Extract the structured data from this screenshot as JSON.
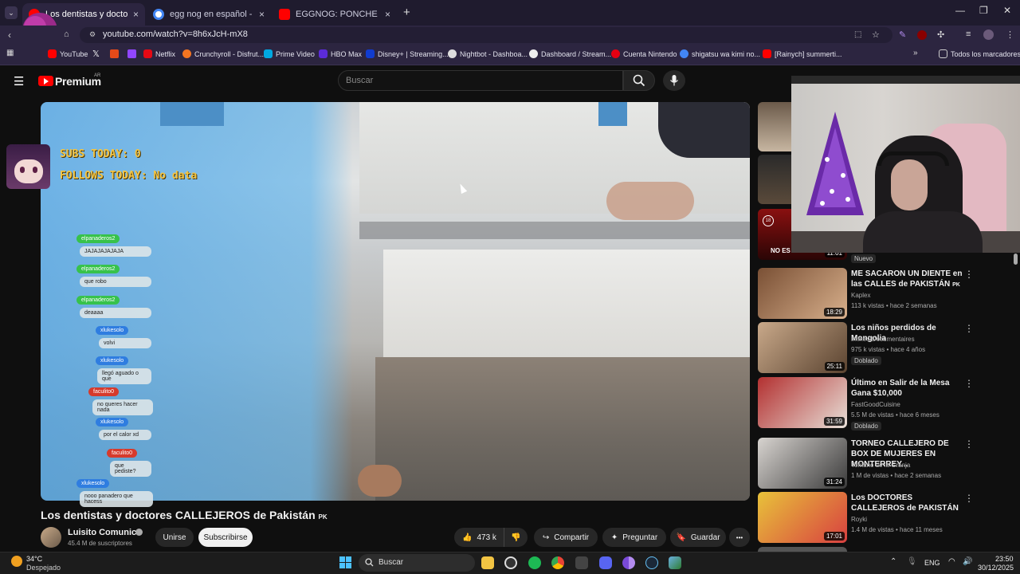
{
  "browser": {
    "tabs": [
      {
        "title": "Los dentistas y doctores CALLEJEROS",
        "active": true
      },
      {
        "title": "egg nog en español - Buscar c...",
        "active": false
      },
      {
        "title": "EGGNOG: PONCHE DE NAVIDA...",
        "active": false
      }
    ],
    "new_tab": "+",
    "close_glyph": "×",
    "url": "youtube.com/watch?v=8h6xJcH-mX8",
    "window_controls": [
      "—",
      "❐",
      "✕"
    ],
    "bookmarks": [
      {
        "label": "YouTube",
        "color": "#ff0000"
      },
      {
        "label": "Netflix",
        "color": "#e50914"
      },
      {
        "label": "Crunchyroll - Disfrut...",
        "color": "#f47521"
      },
      {
        "label": "Prime Video",
        "color": "#00a8e1"
      },
      {
        "label": "HBO Max",
        "color": "#5b2bd9"
      },
      {
        "label": "Disney+ | Streaming...",
        "color": "#113ccf"
      },
      {
        "label": "Nightbot - Dashboa...",
        "color": "#dddddd"
      },
      {
        "label": "Dashboard / Stream...",
        "color": "#eeeeee"
      },
      {
        "label": "Cuenta Nintendo",
        "color": "#e60012"
      },
      {
        "label": "shigatsu wa kimi no...",
        "color": "#4285f4"
      },
      {
        "label": "[Rainych] summerti...",
        "color": "#ff0000"
      }
    ],
    "all_bookmarks": "Todos los marcadores"
  },
  "youtube": {
    "logo": "Premium",
    "region": "AR",
    "search_placeholder": "Buscar",
    "video": {
      "title": "Los dentistas y doctores CALLEJEROS de Pakistán",
      "flag": "PK",
      "channel": "Luisito Comunica",
      "subscribers": "45.4 M de suscriptores",
      "join": "Unirse",
      "subscribe": "Subscribirse",
      "likes": "473 k",
      "share": "Compartir",
      "ask": "Preguntar",
      "save": "Guardar",
      "more": "•••"
    },
    "stream_overlay": {
      "subs_today": "SUBS TODAY: 0",
      "follows_today": "FOLLOWS TODAY: No data",
      "chat": [
        {
          "user": "elpanaderos2",
          "msg": "JAJAJAJAJAJA",
          "color": "#37c24b"
        },
        {
          "user": "elpanaderos2",
          "msg": "que robo",
          "color": "#37c24b"
        },
        {
          "user": "elpanaderos2",
          "msg": "deaaaa",
          "color": "#37c24b"
        },
        {
          "user": "xlukesolo",
          "msg": "volvi",
          "color": "#2f7de0"
        },
        {
          "user": "xlukesolo",
          "msg": "llegó aguado o que",
          "color": "#2f7de0"
        },
        {
          "user": "faculito0",
          "msg": "no queres hacer nada",
          "color": "#d63a2c"
        },
        {
          "user": "xlukesolo",
          "msg": "por el calor xd",
          "color": "#2f7de0"
        },
        {
          "user": "faculito0",
          "msg": "que pediste?",
          "color": "#d63a2c"
        },
        {
          "user": "xlukesolo",
          "msg": "nooo panadero que hacess",
          "color": "#2f7de0"
        }
      ]
    },
    "recommendations": [
      {
        "badge": "Nuevo",
        "title": "",
        "channel": "",
        "meta": "",
        "duration": "11:01",
        "extra": "NO ES"
      },
      {
        "title": "ME SACARON UN DIENTE en las CALLES de PAKISTÁN",
        "flag": "PK",
        "channel": "Kaplex",
        "meta": "113 k vistas • hace 2 semanas",
        "duration": "18:29",
        "badge": ""
      },
      {
        "title": "Los niños perdidos de Mongolia",
        "channel": "imineo Documentaires",
        "meta": "975 k vistas • hace 4 años",
        "duration": "25:11",
        "badge": "Doblado"
      },
      {
        "title": "Último en Salir de la Mesa Gana $10,000",
        "channel": "FastGoodCuisine",
        "meta": "5.5 M de vistas • hace 6 meses",
        "duration": "31:59",
        "badge": "Doblado"
      },
      {
        "title": "TORNEO CALLEJERO DE BOX DE MUJERES EN MONTERREY...",
        "channel": "Tomano de la Granja",
        "meta": "1 M de vistas • hace 2 semanas",
        "duration": "31:24",
        "badge": ""
      },
      {
        "title": "Los DOCTORES CALLEJEROS de PAKISTÁN",
        "channel": "Royki",
        "meta": "1.4 M de vistas • hace 11 meses",
        "duration": "17:01",
        "badge": ""
      }
    ]
  },
  "taskbar": {
    "weather_temp": "34°C",
    "weather_desc": "Despejado",
    "search": "Buscar",
    "lang": "ENG",
    "time": "23:50",
    "date": "30/12/2025"
  }
}
